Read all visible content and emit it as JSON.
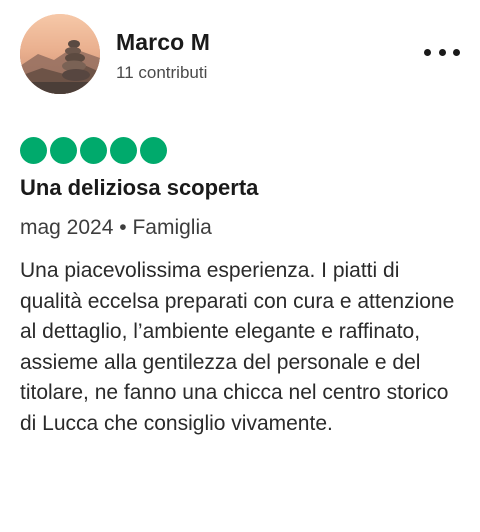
{
  "user": {
    "name": "Marco M",
    "contributions": "11 contributi"
  },
  "menu": {
    "icon": "more-horizontal-icon"
  },
  "review": {
    "rating": 5,
    "rating_max": 5,
    "rating_color": "#00aa6c",
    "title": "Una deliziosa scoperta",
    "date": "mag 2024",
    "separator": "•",
    "trip_type": "Famiglia",
    "body": "Una piacevolissima esperienza. I piatti di qualità eccelsa preparati con cura e attenzione al dettaglio, l’ambiente elegante e raffinato, assieme alla gentilezza del personale e del titolare, ne fanno una chicca nel centro storico di Lucca che consiglio vivamente."
  }
}
